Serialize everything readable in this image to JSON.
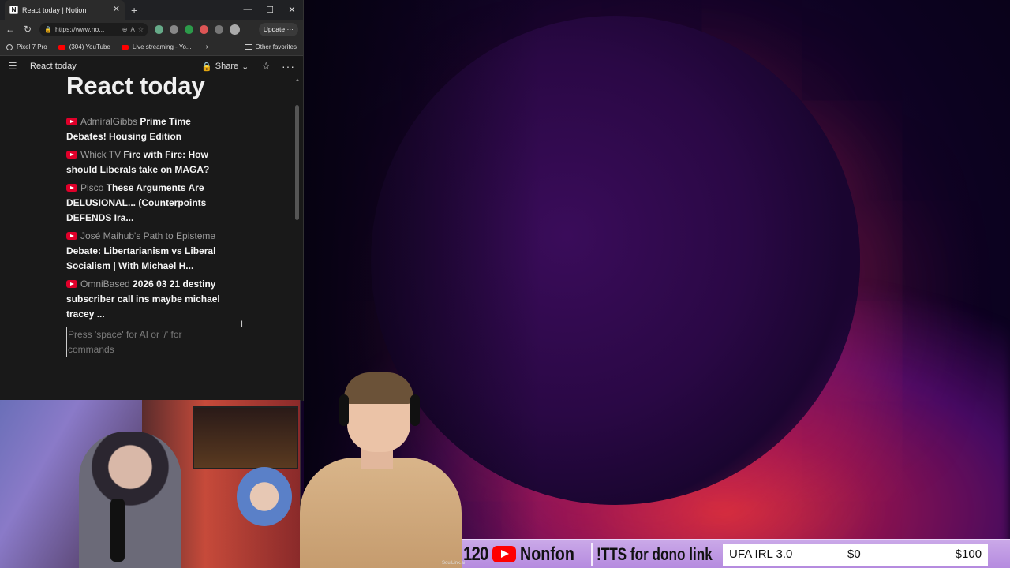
{
  "browser": {
    "tab_title": "React today | Notion",
    "address": "https://www.no...",
    "update_label": "Update",
    "bookmarks": [
      "Pixel 7 Pro",
      "(304) YouTube",
      "Live streaming - Yo..."
    ],
    "other_favorites": "Other favorites"
  },
  "notion": {
    "breadcrumb": "React today",
    "share_label": "Share",
    "page_title": "React today",
    "entries": [
      {
        "channel": "AdmiralGibbs",
        "title": "Prime Time Debates! Housing Edition"
      },
      {
        "channel": "Whick TV",
        "title": "Fire with Fire: How should Liberals take on MAGA?"
      },
      {
        "channel": "Pisco",
        "title": "These Arguments Are DELUSIONAL... (Counterpoints DEFENDS Ira..."
      },
      {
        "channel": "José Maihub's Path to Episteme",
        "title": "Debate: Libertarianism vs Liberal Socialism | With Michael H..."
      },
      {
        "channel": "OmniBased",
        "title": "2026 03 21 destiny subscriber call ins maybe michael tracey ..."
      }
    ],
    "placeholder": "Press 'space' for AI or '/' for commands"
  },
  "ticker": {
    "number": "120",
    "channel": "Nonfon",
    "tts": "!TTS for dono link",
    "goal_name": "UFA IRL 3.0",
    "goal_current": "$0",
    "goal_target": "$100",
    "credit": "SoulLink.ai"
  },
  "colors": {
    "youtube_red": "#ff0000",
    "ticker_bg": "#b58bdf",
    "notion_bg": "#191919"
  }
}
